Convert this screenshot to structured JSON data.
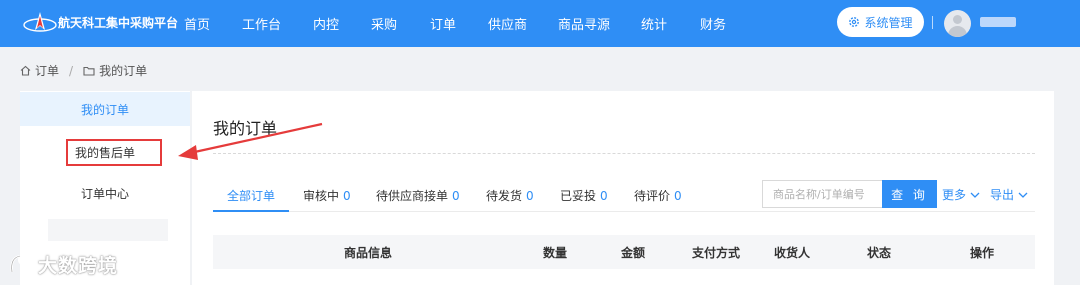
{
  "header": {
    "brand": "航天科工集中采购平台",
    "nav": [
      "首页",
      "工作台",
      "内控",
      "采购",
      "订单",
      "供应商",
      "商品寻源",
      "统计",
      "财务"
    ],
    "system_button": "系统管理"
  },
  "breadcrumb": {
    "home": "订单",
    "current": "我的订单"
  },
  "sidebar": {
    "items": [
      "我的订单",
      "我的售后单",
      "订单中心"
    ]
  },
  "page": {
    "title": "我的订单"
  },
  "tabs": [
    {
      "label": "全部订单",
      "count": ""
    },
    {
      "label": "审核中",
      "count": "0"
    },
    {
      "label": "待供应商接单",
      "count": "0"
    },
    {
      "label": "待发货",
      "count": "0"
    },
    {
      "label": "已妥投",
      "count": "0"
    },
    {
      "label": "待评价",
      "count": "0"
    }
  ],
  "search": {
    "placeholder": "商品名称/订单编号",
    "button": "查 询",
    "more": "更多",
    "export": "导出"
  },
  "table": {
    "headers": [
      "商品信息",
      "数量",
      "金额",
      "支付方式",
      "收货人",
      "状态",
      "操作"
    ]
  },
  "watermark": {
    "text": "大数跨境"
  },
  "colors": {
    "primary": "#2f8ef5",
    "highlight": "#e53b3b"
  }
}
